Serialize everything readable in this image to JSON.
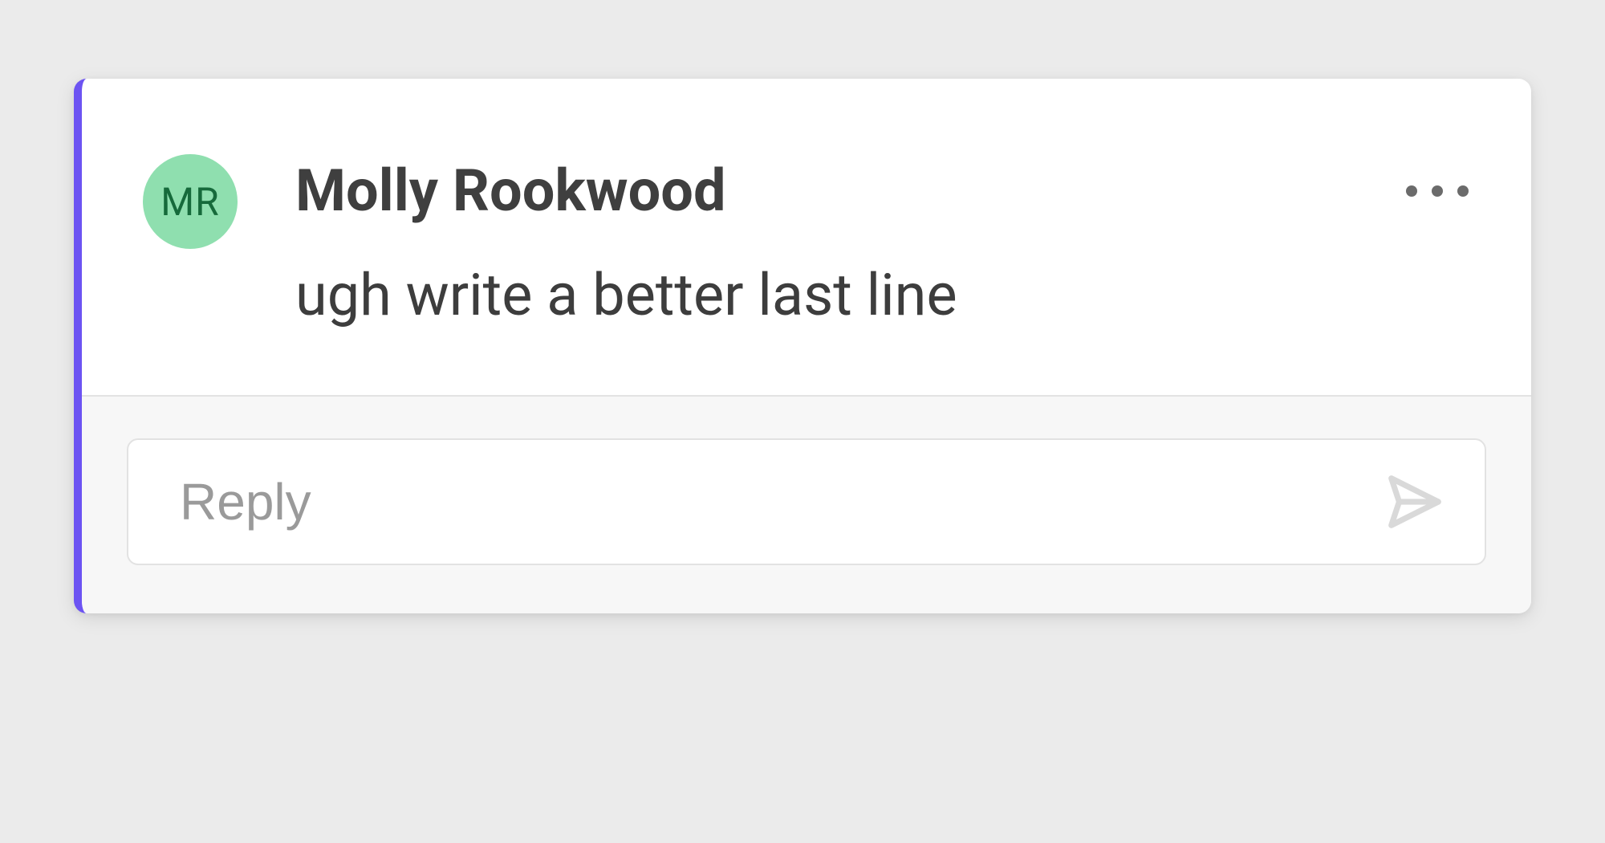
{
  "comment": {
    "avatar": {
      "initials": "MR",
      "bg_color": "#8fdfaf",
      "text_color": "#166a3b"
    },
    "author": "Molly Rookwood",
    "body": "ugh write a better last line",
    "accent_color": "#6c53f2"
  },
  "reply": {
    "placeholder": "Reply",
    "value": ""
  },
  "icons": {
    "more": "more-icon",
    "send": "send-icon"
  }
}
